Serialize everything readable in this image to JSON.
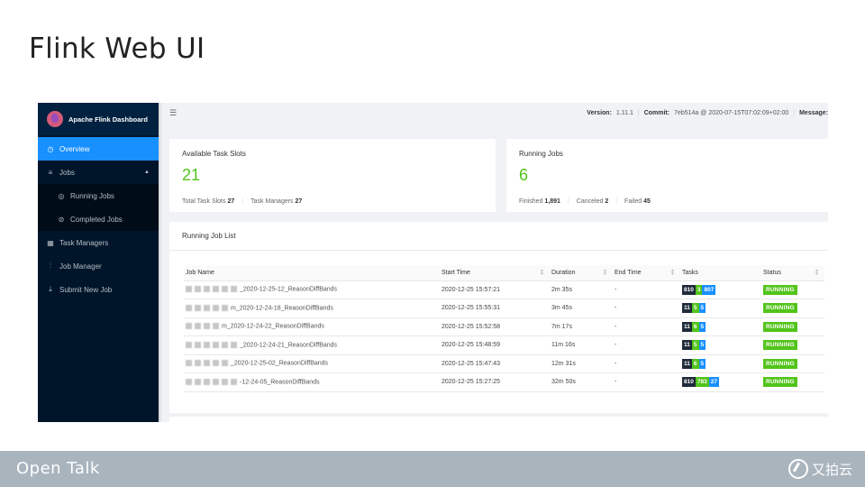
{
  "slide": {
    "title": "Flink Web UI",
    "footer_left": "Open Talk",
    "footer_right": "又拍云"
  },
  "app": {
    "name": "Apache Flink Dashboard",
    "accent_color": "#1890ff",
    "sidebar_bg": "#001529"
  },
  "sidebar": {
    "items": [
      {
        "label": "Overview",
        "icon": "dashboard-icon",
        "active": true
      },
      {
        "label": "Jobs",
        "icon": "list-icon",
        "expanded": true
      },
      {
        "label": "Running Jobs",
        "icon": "play-circle-icon",
        "sub": true
      },
      {
        "label": "Completed Jobs",
        "icon": "check-circle-icon",
        "sub": true
      },
      {
        "label": "Task Managers",
        "icon": "schedule-icon"
      },
      {
        "label": "Job Manager",
        "icon": "build-icon"
      },
      {
        "label": "Submit New Job",
        "icon": "upload-icon"
      }
    ]
  },
  "topbar": {
    "version_label": "Version:",
    "version": "1.11.1",
    "commit_label": "Commit:",
    "commit": "7eb514a @ 2020-07-15T07:02:09+02:00",
    "message_label": "Message:"
  },
  "slots_card": {
    "title": "Available Task Slots",
    "value": "21",
    "total_label": "Total Task Slots",
    "total": "27",
    "tm_label": "Task Managers",
    "tm": "27"
  },
  "jobs_card": {
    "title": "Running Jobs",
    "value": "6",
    "finished_label": "Finished",
    "finished": "1,891",
    "canceled_label": "Canceled",
    "canceled": "2",
    "failed_label": "Failed",
    "failed": "45"
  },
  "job_list": {
    "title": "Running Job List",
    "columns": [
      "Job Name",
      "Start Time",
      "Duration",
      "End Time",
      "Tasks",
      "Status"
    ],
    "rows": [
      {
        "name": "_2020-12-25-12_ReasonDiffBands",
        "start": "2020-12-25 15:57:21",
        "duration": "2m 35s",
        "end": "-",
        "t_total": "810",
        "t_run": "3",
        "t_done": "807",
        "status": "RUNNING"
      },
      {
        "name": "m_2020-12-24-18_ReasonDiffBands",
        "start": "2020-12-25 15:55:31",
        "duration": "3m 45s",
        "end": "-",
        "t_total": "11",
        "t_run": "5",
        "t_done": "5",
        "status": "RUNNING"
      },
      {
        "name": "m_2020-12-24-22_ReasonDiffBands",
        "start": "2020-12-25 15:52:58",
        "duration": "7m 17s",
        "end": "-",
        "t_total": "11",
        "t_run": "6",
        "t_done": "5",
        "status": "RUNNING"
      },
      {
        "name": "_2020-12-24-21_ReasonDiffBands",
        "start": "2020-12-25 15:48:59",
        "duration": "11m 16s",
        "end": "-",
        "t_total": "11",
        "t_run": "5",
        "t_done": "5",
        "status": "RUNNING"
      },
      {
        "name": "_2020-12-25-02_ReasonDiffBands",
        "start": "2020-12-25 15:47:43",
        "duration": "12m 31s",
        "end": "-",
        "t_total": "11",
        "t_run": "6",
        "t_done": "5",
        "status": "RUNNING"
      },
      {
        "name": "-12-24-05_ReasonDiffBands",
        "start": "2020-12-25 15:27:25",
        "duration": "32m 50s",
        "end": "-",
        "t_total": "810",
        "t_run": "783",
        "t_done": "27",
        "status": "RUNNING"
      }
    ]
  }
}
